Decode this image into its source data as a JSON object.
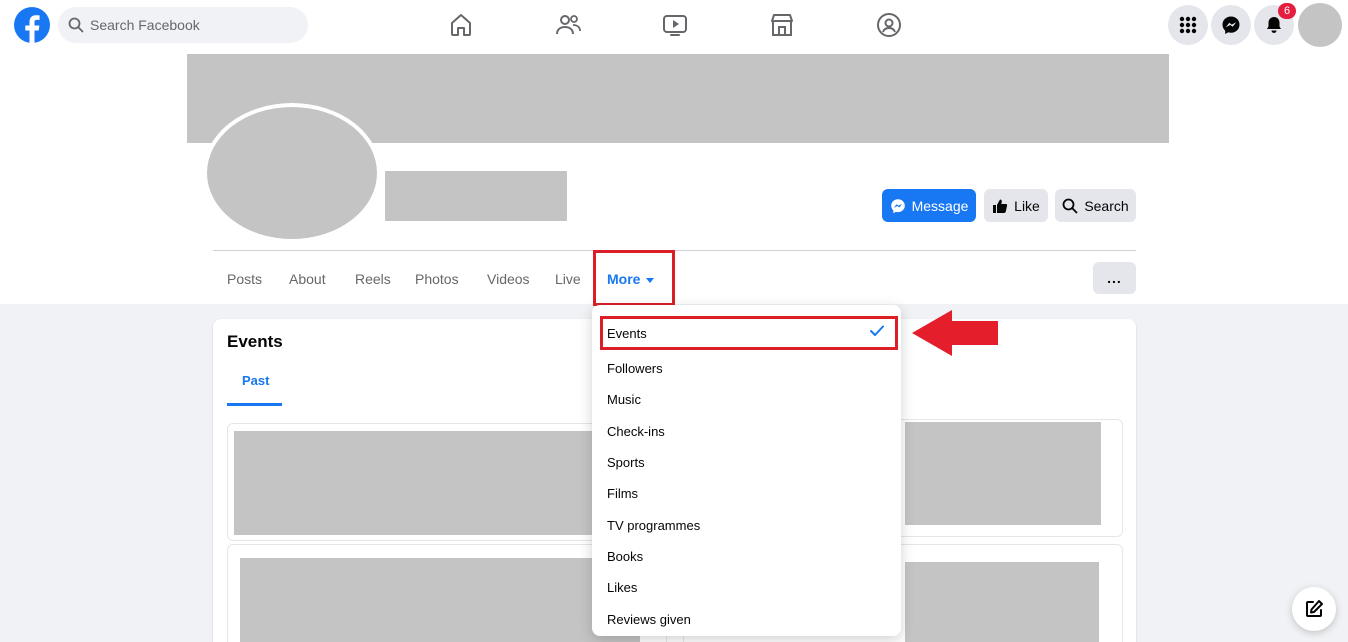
{
  "topbar": {
    "search_placeholder": "Search Facebook",
    "notification_count": "6",
    "nav_icons": [
      "home-icon",
      "friends-icon",
      "watch-icon",
      "marketplace-icon",
      "groups-icon"
    ]
  },
  "profile": {
    "buttons": {
      "message": "Message",
      "like": "Like",
      "search": "Search"
    },
    "tabs": {
      "posts": "Posts",
      "about": "About",
      "reels": "Reels",
      "photos": "Photos",
      "videos": "Videos",
      "live": "Live",
      "more": "More"
    },
    "more_options_label": "..."
  },
  "events": {
    "title": "Events",
    "tab_past": "Past"
  },
  "dropdown": {
    "items": [
      "Events",
      "Followers",
      "Music",
      "Check-ins",
      "Sports",
      "Films",
      "TV programmes",
      "Books",
      "Likes",
      "Reviews given"
    ],
    "selected": "Events"
  },
  "colors": {
    "brand": "#1877f2",
    "highlight": "#dc1f26",
    "badge": "#e41e3f",
    "placeholder": "#c4c4c4"
  }
}
